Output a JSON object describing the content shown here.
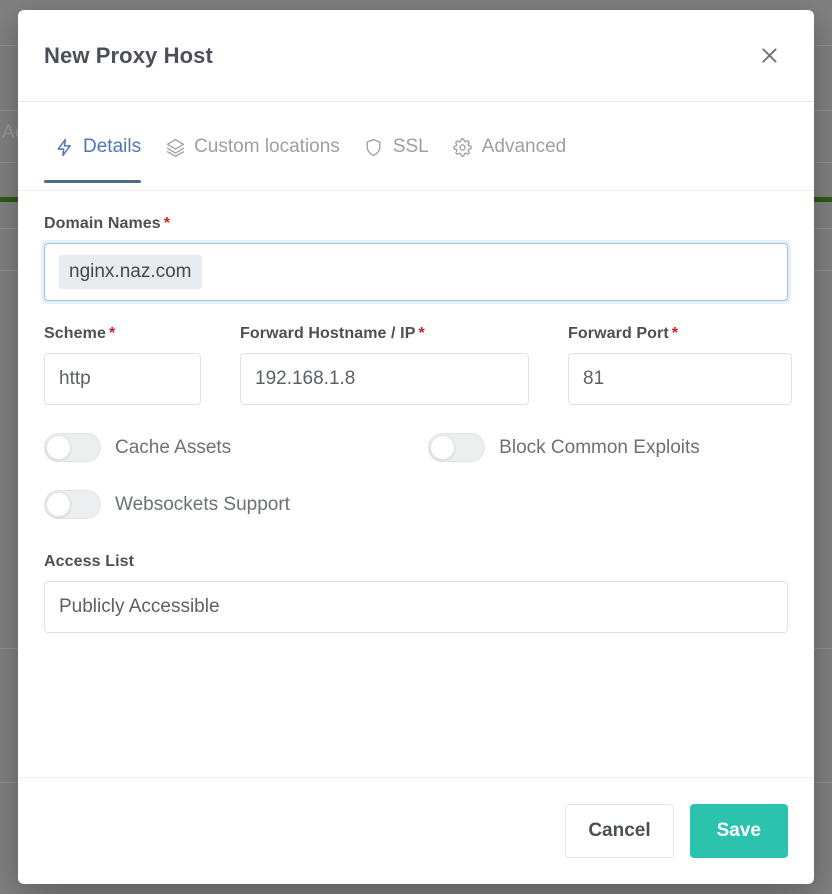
{
  "background": {
    "partial_text": "Ac",
    "accent_line_color": "#2e5a13",
    "overlay_color": "#808080"
  },
  "modal": {
    "title": "New Proxy Host",
    "close_icon": "close-icon",
    "tabs": [
      {
        "label": "Details",
        "icon": "zap-icon",
        "active": true
      },
      {
        "label": "Custom locations",
        "icon": "layers-icon",
        "active": false
      },
      {
        "label": "SSL",
        "icon": "shield-icon",
        "active": false
      },
      {
        "label": "Advanced",
        "icon": "gear-icon",
        "active": false
      }
    ],
    "active_tab_accent": "#4a78b8",
    "fields": {
      "domain_names": {
        "label": "Domain Names",
        "required_marker": "*",
        "tags": [
          "nginx.naz.com"
        ],
        "focused": true
      },
      "scheme": {
        "label": "Scheme",
        "required_marker": "*",
        "value": "http"
      },
      "forward_hostname": {
        "label": "Forward Hostname / IP",
        "required_marker": "*",
        "value": "192.168.1.8"
      },
      "forward_port": {
        "label": "Forward Port",
        "required_marker": "*",
        "value": "81"
      },
      "access_list": {
        "label": "Access List",
        "value": "Publicly Accessible"
      }
    },
    "toggles": [
      {
        "label": "Cache Assets",
        "on": false
      },
      {
        "label": "Block Common Exploits",
        "on": false
      },
      {
        "label": "Websockets Support",
        "on": false
      }
    ],
    "footer": {
      "cancel_label": "Cancel",
      "save_label": "Save",
      "save_color": "#2bc3ad"
    }
  }
}
